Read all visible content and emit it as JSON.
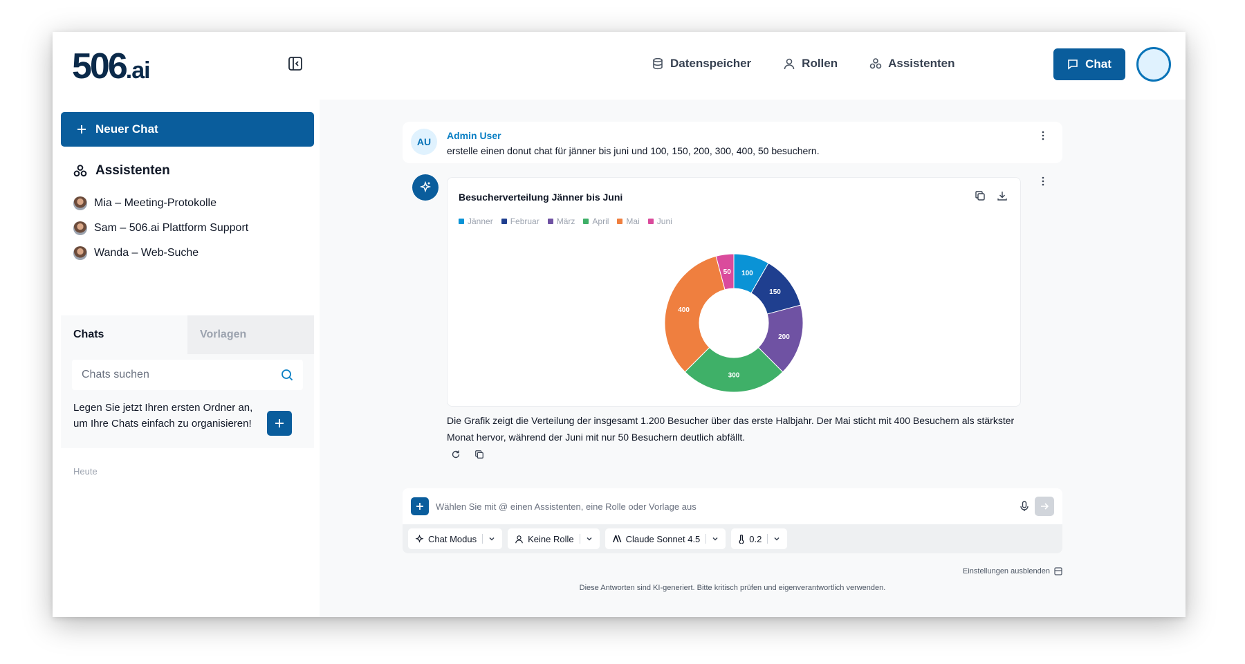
{
  "brand": {
    "logo_main": "506",
    "logo_suffix": ".ai"
  },
  "header": {
    "nav": [
      {
        "label": "Datenspeicher",
        "icon": "database-icon"
      },
      {
        "label": "Rollen",
        "icon": "user-icon"
      },
      {
        "label": "Assistenten",
        "icon": "assistants-icon"
      }
    ],
    "chat_button": "Chat"
  },
  "sidebar": {
    "new_chat": "Neuer Chat",
    "assistants_title": "Assistenten",
    "assistants": [
      {
        "label": "Mia – Meeting-Protokolle"
      },
      {
        "label": "Sam – 506.ai Plattform Support"
      },
      {
        "label": "Wanda – Web-Suche"
      }
    ],
    "tabs": {
      "chats": "Chats",
      "templates": "Vorlagen"
    },
    "search_placeholder": "Chats suchen",
    "folder_hint": "Legen Sie jetzt Ihren ersten Ordner an, um Ihre Chats einfach zu organisieren!",
    "section_today": "Heute"
  },
  "conversation": {
    "user": {
      "initials": "AU",
      "name": "Admin User",
      "text": "erstelle einen donut chat für jänner bis juni und 100, 150, 200, 300, 400, 50 besuchern."
    },
    "answer_text": "Die Grafik zeigt die Verteilung der insgesamt 1.200 Besucher über das erste Halbjahr. Der Mai sticht mit 400 Besuchern als stärkster Monat hervor, während der Juni mit nur 50 Besuchern deutlich abfällt."
  },
  "chart_data": {
    "type": "pie",
    "variant": "donut",
    "title": "Besucherverteilung Jänner bis Juni",
    "categories": [
      "Jänner",
      "Februar",
      "März",
      "April",
      "Mai",
      "Juni"
    ],
    "values": [
      100,
      150,
      200,
      300,
      400,
      50
    ],
    "colors": [
      "#0a93d6",
      "#1f3f8f",
      "#6f52a3",
      "#3fb068",
      "#ef7f3f",
      "#da4b9c"
    ],
    "legend_position": "top-left"
  },
  "composer": {
    "placeholder": "Wählen Sie mit @ einen Assistenten, eine Rolle oder Vorlage aus",
    "mode": "Chat Modus",
    "role": "Keine Rolle",
    "model": "Claude Sonnet 4.5",
    "temperature": "0.2"
  },
  "footer": {
    "settings_toggle": "Einstellungen ausblenden",
    "disclaimer": "Diese Antworten sind KI-generiert. Bitte kritisch prüfen und eigenverantwortlich verwenden."
  },
  "colors": {
    "primary": "#0a5d9c",
    "accent_text": "#0a7fc4",
    "main_bg": "#f8f9fa"
  }
}
